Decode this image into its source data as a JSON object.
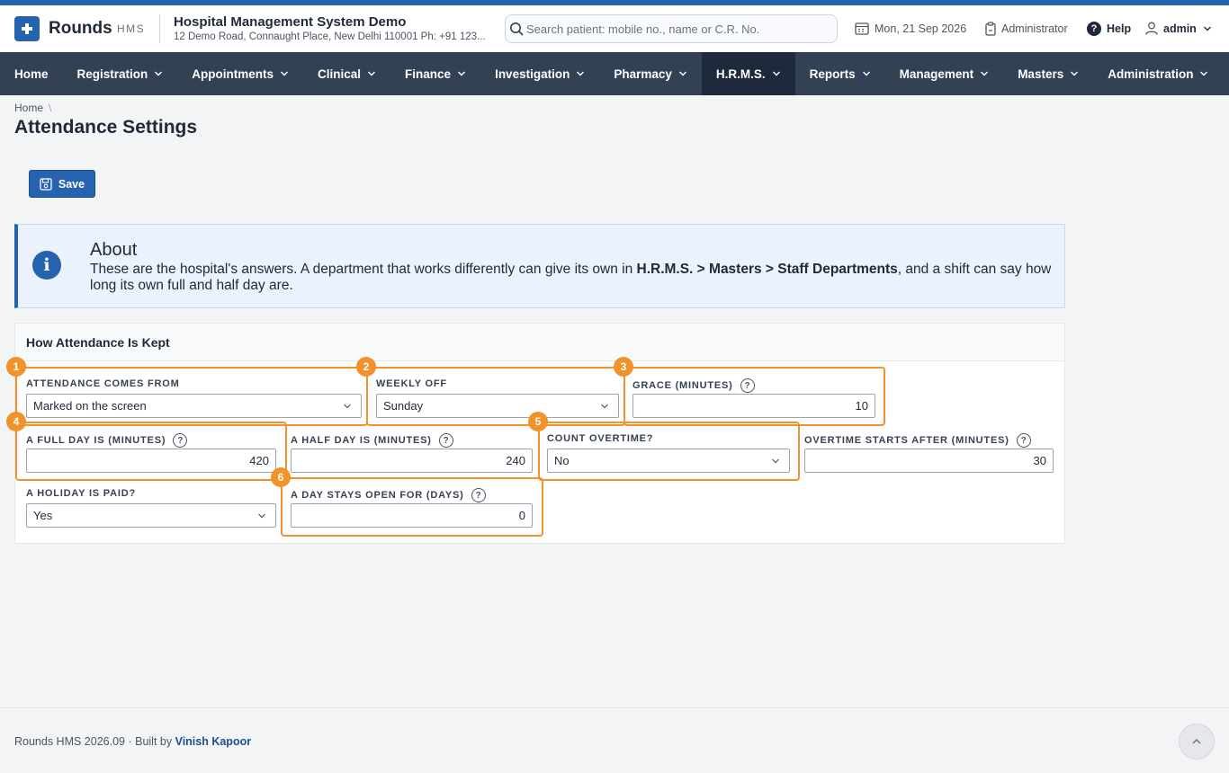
{
  "header": {
    "brand": "Rounds",
    "brand_sub": "HMS",
    "hospital_name": "Hospital Management System Demo",
    "hospital_address": "12 Demo Road, Connaught Place, New Delhi 110001 Ph: +91 123...",
    "search_placeholder": "Search patient: mobile no., name or C.R. No.",
    "date": "Mon, 21 Sep 2026",
    "role": "Administrator",
    "help_label": "Help",
    "user": "admin"
  },
  "nav": {
    "items": [
      {
        "label": "Home"
      },
      {
        "label": "Registration"
      },
      {
        "label": "Appointments"
      },
      {
        "label": "Clinical"
      },
      {
        "label": "Finance"
      },
      {
        "label": "Investigation"
      },
      {
        "label": "Pharmacy"
      },
      {
        "label": "H.R.M.S."
      },
      {
        "label": "Reports"
      },
      {
        "label": "Management"
      },
      {
        "label": "Masters"
      },
      {
        "label": "Administration"
      }
    ],
    "active": "H.R.M.S."
  },
  "breadcrumb": {
    "home": "Home",
    "separator": "\\"
  },
  "page": {
    "title": "Attendance Settings",
    "save_label": "Save"
  },
  "about": {
    "title": "About",
    "text_before": "These are the hospital's answers. A department that works differently can give its own in ",
    "text_bold": "H.R.M.S. > Masters > Staff Departments",
    "text_after": ", and a shift can say how long its own full and half day are."
  },
  "settings_card": {
    "title": "How Attendance Is Kept",
    "fields": {
      "attendance_source": {
        "label": "ATTENDANCE COMES FROM",
        "value": "Marked on the screen"
      },
      "weekly_off": {
        "label": "WEEKLY OFF",
        "value": "Sunday"
      },
      "grace_minutes": {
        "label": "GRACE (MINUTES)",
        "value": "10"
      },
      "full_day_minutes": {
        "label": "A FULL DAY IS (MINUTES)",
        "value": "420"
      },
      "half_day_minutes": {
        "label": "A HALF DAY IS (MINUTES)",
        "value": "240"
      },
      "count_overtime": {
        "label": "COUNT OVERTIME?",
        "value": "No"
      },
      "overtime_after_minutes": {
        "label": "OVERTIME STARTS AFTER (MINUTES)",
        "value": "30"
      },
      "holiday_paid": {
        "label": "A HOLIDAY IS PAID?",
        "value": "Yes"
      },
      "day_open_days": {
        "label": "A DAY STAYS OPEN FOR (DAYS)",
        "value": "0"
      }
    },
    "help_glyph": "?"
  },
  "callouts": [
    "1",
    "2",
    "3",
    "4",
    "5",
    "6"
  ],
  "footer": {
    "text": "Rounds HMS 2026.09 · Built by ",
    "author": "Vinish Kapoor"
  },
  "colors": {
    "primary": "#2563ae",
    "nav_bg": "#334155",
    "nav_active": "#1e293b",
    "highlight": "#f0932b",
    "about_bg": "#eaf2fb"
  },
  "icons": {
    "logo": "plus-icon",
    "search": "search-icon",
    "date": "calendar-icon",
    "role": "clipboard-icon",
    "help": "question-circle-icon",
    "user": "user-icon",
    "info": "info-icon",
    "save": "floppy-disk-icon",
    "back_to_top": "chevron-up-icon"
  }
}
